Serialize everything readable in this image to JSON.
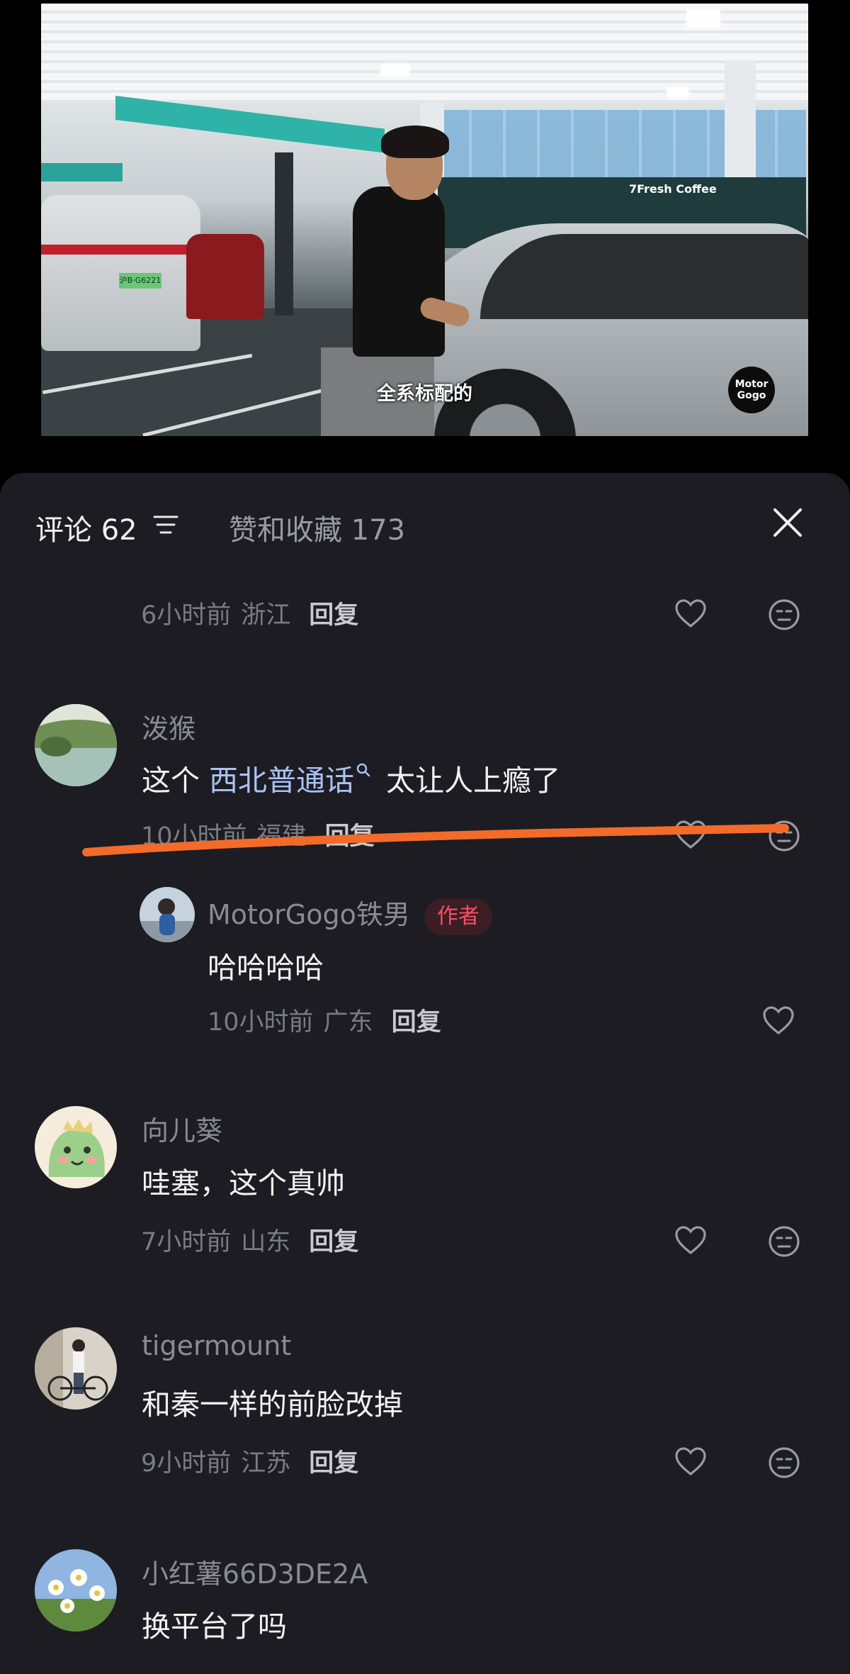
{
  "video": {
    "subtitle": "全系标配的",
    "logo_line1": "Motor",
    "logo_line2": "Gogo",
    "store_sign": "7Fresh Coffee",
    "plate": "沪B·G6221"
  },
  "header": {
    "comments_tab": "评论 62",
    "likes_tab": "赞和收藏 173",
    "filter_icon": "sort-filter-icon",
    "close_icon": "close-icon"
  },
  "comments": [
    {
      "time": "6小时前",
      "region": "浙江",
      "reply": "回复"
    },
    {
      "username": "泼猴",
      "text_before": "这个 ",
      "keyword": "西北普通话",
      "text_after": " 太让人上瘾了",
      "time": "10小时前",
      "region": "福建",
      "reply": "回复"
    },
    {
      "username": "MotorGogo铁男",
      "badge": "作者",
      "text": "哈哈哈哈",
      "time": "10小时前",
      "region": "广东",
      "reply": "回复"
    },
    {
      "username": "向儿葵",
      "text": "哇塞，这个真帅",
      "time": "7小时前",
      "region": "山东",
      "reply": "回复"
    },
    {
      "username": "tigermount",
      "text": "和秦一样的前脸改掉",
      "time": "9小时前",
      "region": "江苏",
      "reply": "回复"
    },
    {
      "username": "小红薯66D3DE2A",
      "text": "换平台了吗"
    }
  ],
  "colors": {
    "sheet_bg": "#1c1c22",
    "keyword": "#aac3f2",
    "author_badge": "#ff4d62",
    "annotation_stroke": "#f26b2a"
  }
}
